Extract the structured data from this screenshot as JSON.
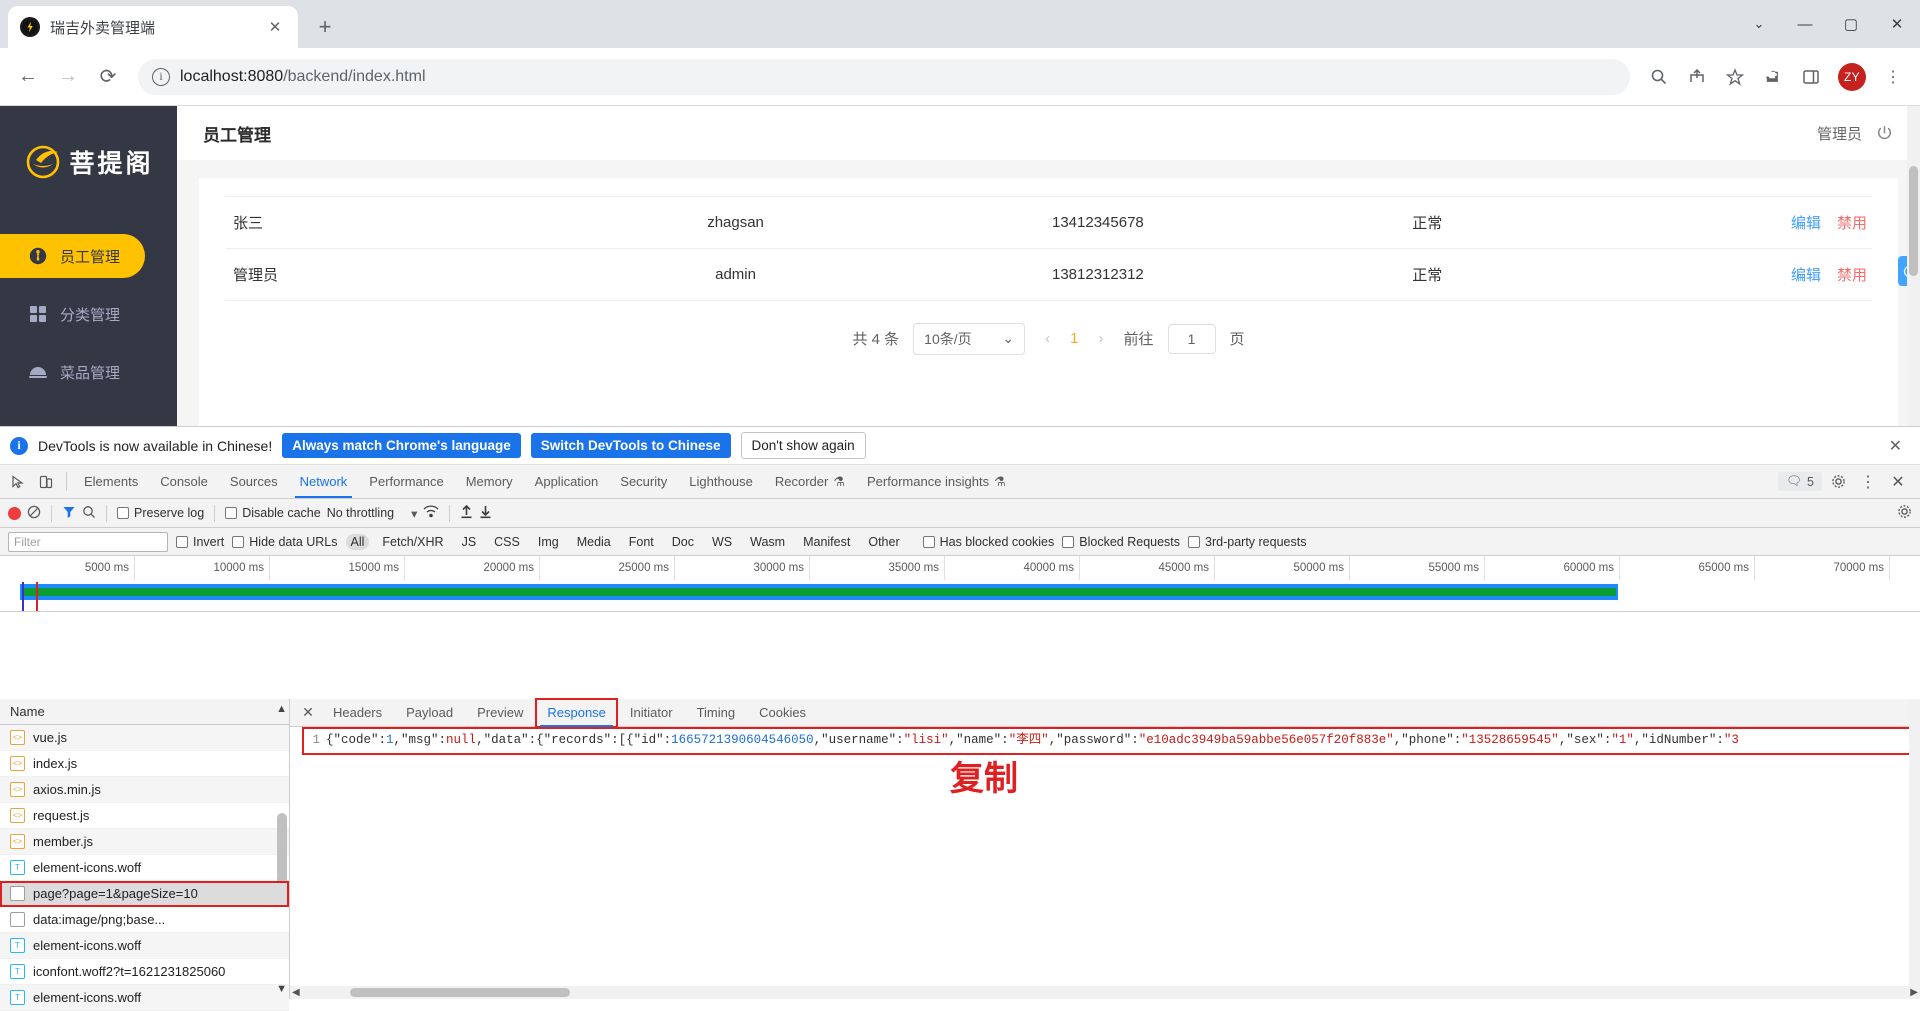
{
  "browser": {
    "tab": {
      "title": "瑞吉外卖管理端",
      "favicon": "app-logo-icon",
      "close": "✕"
    },
    "new_tab_label": "+",
    "window_controls": {
      "minimize": "—",
      "maximize": "▢",
      "close": "✕",
      "chevron": "⌄"
    },
    "nav": {
      "back": "←",
      "forward": "→",
      "reload": "⟳"
    },
    "omnibox": {
      "info_icon": "ⓘ",
      "url_host": "localhost:8080",
      "url_path": "/backend/index.html"
    },
    "toolbar_icons": [
      "zoom-icon",
      "share-icon",
      "bookmark-star-icon",
      "extensions-icon",
      "sidepanel-icon"
    ],
    "avatar": "ZY",
    "menu": "⋮"
  },
  "webapp": {
    "brand": "菩提阁",
    "sidebar": [
      {
        "label": "员工管理",
        "icon": "employee-icon",
        "active": true
      },
      {
        "label": "分类管理",
        "icon": "category-icon",
        "active": false
      },
      {
        "label": "菜品管理",
        "icon": "dish-icon",
        "active": false
      }
    ],
    "header": {
      "title": "员工管理",
      "user": "管理员",
      "logout_icon": "power-icon"
    },
    "table": {
      "rows": [
        {
          "name": "张三",
          "username": "zhagsan",
          "phone": "13412345678",
          "status": "正常",
          "edit": "编辑",
          "disable": "禁用"
        },
        {
          "name": "管理员",
          "username": "admin",
          "phone": "13812312312",
          "status": "正常",
          "edit": "编辑",
          "disable": "禁用"
        }
      ]
    },
    "pagination": {
      "total": "共 4 条",
      "page_size": "10条/页",
      "prev": "‹",
      "current_page": "1",
      "next": "›",
      "jump_label": "前往",
      "jump_value": "1",
      "page_unit": "页"
    },
    "float_button": "service-icon"
  },
  "devtools": {
    "notification": {
      "text": "DevTools is now available in Chinese!",
      "btn_always": "Always match Chrome's language",
      "btn_switch": "Switch DevTools to Chinese",
      "btn_dismiss": "Don't show again",
      "close": "✕"
    },
    "tabs": [
      {
        "label": "Elements",
        "active": false
      },
      {
        "label": "Console",
        "active": false
      },
      {
        "label": "Sources",
        "active": false
      },
      {
        "label": "Network",
        "active": true
      },
      {
        "label": "Performance",
        "active": false
      },
      {
        "label": "Memory",
        "active": false
      },
      {
        "label": "Application",
        "active": false
      },
      {
        "label": "Security",
        "active": false
      },
      {
        "label": "Lighthouse",
        "active": false
      },
      {
        "label": "Recorder",
        "active": false,
        "badge": "experiment"
      },
      {
        "label": "Performance insights",
        "active": false,
        "badge": "experiment"
      }
    ],
    "tabs_right": {
      "message_count": "5",
      "settings_icon": "gear-icon",
      "more_icon": "kebab-icon",
      "close_icon": "close-icon"
    },
    "network_toolbar": {
      "record": "record-icon",
      "clear": "clear-icon",
      "filter": "filter-icon",
      "search": "search-icon",
      "preserve_log": "Preserve log",
      "disable_cache": "Disable cache",
      "throttling": "No throttling",
      "throttling_caret": "▾",
      "wifi_icon": "network-conditions-icon",
      "import_icon": "import-har-icon",
      "export_icon": "export-har-icon",
      "settings_icon": "network-settings-icon"
    },
    "filter_bar": {
      "placeholder": "Filter",
      "invert": "Invert",
      "hide_data_urls": "Hide data URLs",
      "types": [
        "All",
        "Fetch/XHR",
        "JS",
        "CSS",
        "Img",
        "Media",
        "Font",
        "Doc",
        "WS",
        "Wasm",
        "Manifest",
        "Other"
      ],
      "selected_type": "All",
      "has_blocked_cookies": "Has blocked cookies",
      "blocked_requests": "Blocked Requests",
      "third_party": "3rd-party requests"
    },
    "timeline": {
      "ticks": [
        "5000 ms",
        "10000 ms",
        "15000 ms",
        "20000 ms",
        "25000 ms",
        "30000 ms",
        "35000 ms",
        "40000 ms",
        "45000 ms",
        "50000 ms",
        "55000 ms",
        "60000 ms",
        "65000 ms",
        "70000 ms"
      ],
      "bar_color": "#1a8cff",
      "load_color": "#0a9d34"
    },
    "request_list": {
      "header": "Name",
      "rows": [
        {
          "name": "vue.js",
          "type": "js"
        },
        {
          "name": "index.js",
          "type": "js"
        },
        {
          "name": "axios.min.js",
          "type": "js"
        },
        {
          "name": "request.js",
          "type": "js"
        },
        {
          "name": "member.js",
          "type": "js"
        },
        {
          "name": "element-icons.woff",
          "type": "font"
        },
        {
          "name": "page?page=1&pageSize=10",
          "type": "doc",
          "selected": true,
          "highlighted": true
        },
        {
          "name": "data:image/png;base...",
          "type": "doc"
        },
        {
          "name": "element-icons.woff",
          "type": "font"
        },
        {
          "name": "iconfont.woff2?t=1621231825060",
          "type": "font"
        },
        {
          "name": "element-icons.woff",
          "type": "font"
        }
      ]
    },
    "detail": {
      "close": "✕",
      "tabs": [
        {
          "label": "Headers",
          "active": false
        },
        {
          "label": "Payload",
          "active": false
        },
        {
          "label": "Preview",
          "active": false
        },
        {
          "label": "Response",
          "active": true,
          "highlighted": true
        },
        {
          "label": "Initiator",
          "active": false
        },
        {
          "label": "Timing",
          "active": false
        },
        {
          "label": "Cookies",
          "active": false
        }
      ],
      "response": {
        "line_number": "1",
        "segments": [
          {
            "text": "{\"code\":",
            "cls": "c-key"
          },
          {
            "text": "1",
            "cls": "c-num"
          },
          {
            "text": ",\"msg\":",
            "cls": "c-key"
          },
          {
            "text": "null",
            "cls": "c-null"
          },
          {
            "text": ",\"data\":{\"records\":[{\"id\":",
            "cls": "c-key"
          },
          {
            "text": "1665721390604546050",
            "cls": "c-num"
          },
          {
            "text": ",\"username\":",
            "cls": "c-key"
          },
          {
            "text": "\"lisi\"",
            "cls": "c-str"
          },
          {
            "text": ",\"name\":",
            "cls": "c-key"
          },
          {
            "text": "\"李四\"",
            "cls": "c-str"
          },
          {
            "text": ",\"password\":",
            "cls": "c-key"
          },
          {
            "text": "\"e10adc3949ba59abbe56e057f20f883e\"",
            "cls": "c-str"
          },
          {
            "text": ",\"phone\":",
            "cls": "c-key"
          },
          {
            "text": "\"13528659545\"",
            "cls": "c-str"
          },
          {
            "text": ",\"sex\":",
            "cls": "c-key"
          },
          {
            "text": "\"1\"",
            "cls": "c-str"
          },
          {
            "text": ",\"idNumber\":",
            "cls": "c-key"
          },
          {
            "text": "\"3",
            "cls": "c-str"
          }
        ]
      },
      "annotation": "复制"
    }
  }
}
